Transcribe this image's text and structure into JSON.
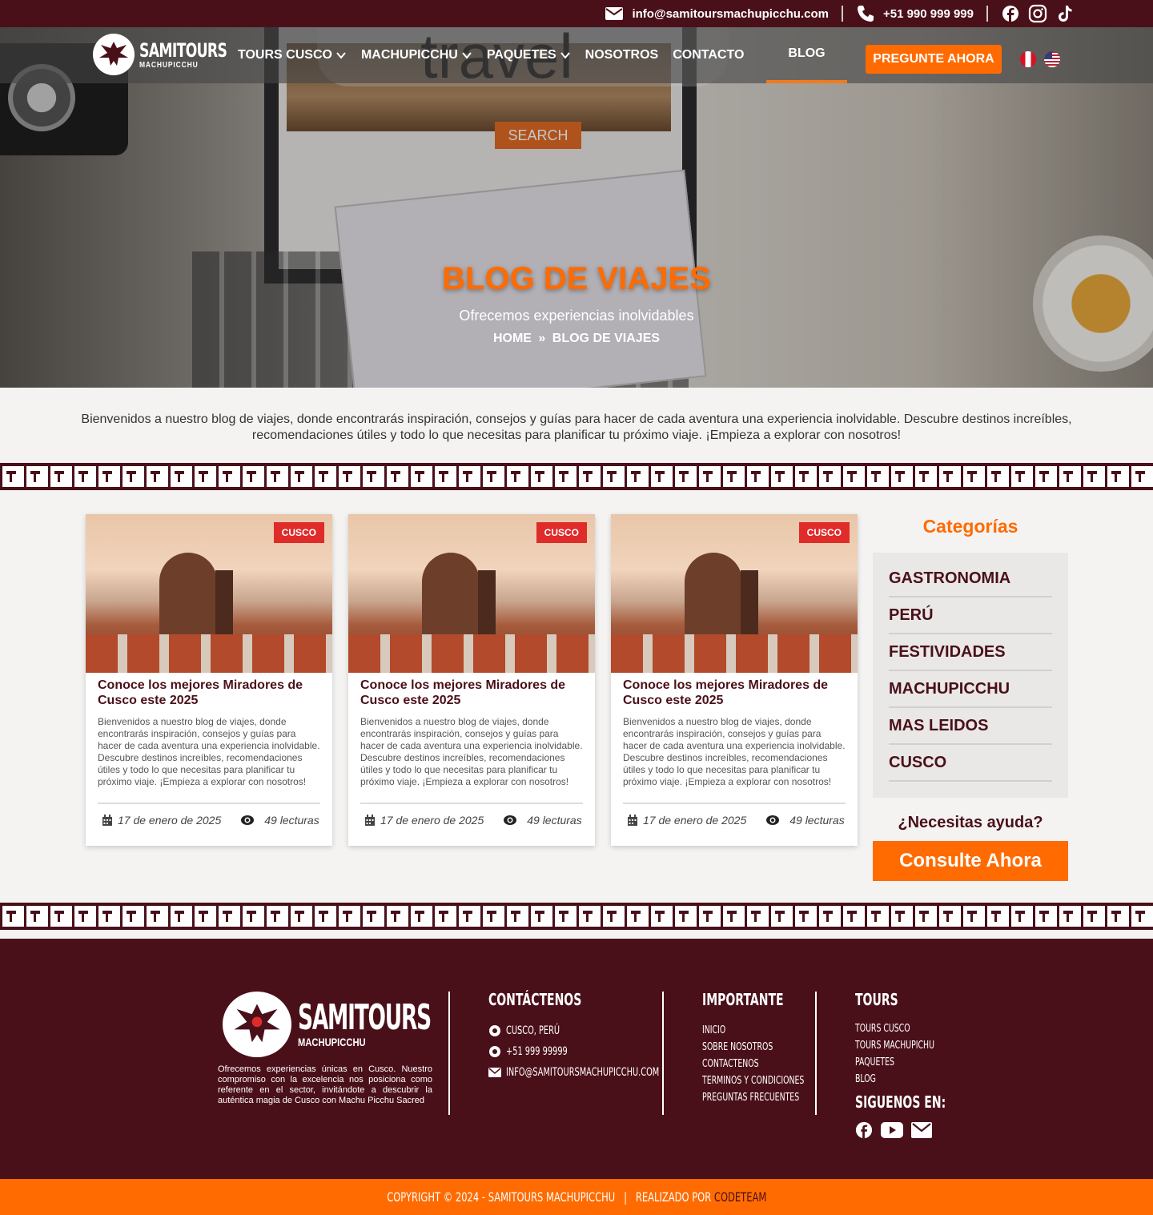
{
  "topbar": {
    "email": "info@samitoursmachupicchu.com",
    "phone": "+51 990 999 999",
    "social_icons": [
      "facebook-icon",
      "instagram-icon",
      "tiktok-icon"
    ]
  },
  "logo": {
    "brand": "SAMITOURS",
    "sub": "MACHUPICCHU"
  },
  "nav": {
    "items": [
      {
        "label": "TOURS CUSCO",
        "dropdown": true
      },
      {
        "label": "MACHUPICCHU",
        "dropdown": true
      },
      {
        "label": "PAQUETES",
        "dropdown": true
      },
      {
        "label": "NOSOTROS",
        "dropdown": false
      },
      {
        "label": "CONTACTO",
        "dropdown": false
      }
    ],
    "active": "BLOG",
    "cta": "PREGUNTE AHORA"
  },
  "hero": {
    "title": "BLOG DE VIAJES",
    "subtitle": "Ofrecemos experiencias inolvidables",
    "breadcrumb": {
      "home": "HOME",
      "separator": "»",
      "current": "BLOG DE VIAJES"
    },
    "image_text": {
      "travel": "travel",
      "search": "SEARCH"
    }
  },
  "intro": "Bienvenidos a nuestro blog de viajes, donde encontrarás inspiración, consejos y guías para hacer de cada aventura una experiencia inolvidable. Descubre destinos increíbles, recomendaciones útiles y todo lo que necesitas para planificar tu próximo viaje. ¡Empieza a explorar con nosotros!",
  "posts": [
    {
      "badge": "CUSCO",
      "title": "Conoce los mejores Miradores de Cusco este 2025",
      "excerpt": "Bienvenidos a nuestro blog de viajes, donde encontrarás inspiración, consejos y guías para hacer de cada aventura una experiencia inolvidable. Descubre destinos increíbles, recomendaciones útiles y todo lo que necesitas para planificar tu próximo viaje. ¡Empieza a explorar con nosotros!",
      "date": "17 de enero de 2025",
      "reads": "49 lecturas"
    },
    {
      "badge": "CUSCO",
      "title": "Conoce los mejores Miradores de Cusco este 2025",
      "excerpt": "Bienvenidos a nuestro blog de viajes, donde encontrarás inspiración, consejos y guías para hacer de cada aventura una experiencia inolvidable. Descubre destinos increíbles, recomendaciones útiles y todo lo que necesitas para planificar tu próximo viaje. ¡Empieza a explorar con nosotros!",
      "date": "17 de enero de 2025",
      "reads": "49 lecturas"
    },
    {
      "badge": "CUSCO",
      "title": "Conoce los mejores Miradores de Cusco este 2025",
      "excerpt": "Bienvenidos a nuestro blog de viajes, donde encontrarás inspiración, consejos y guías para hacer de cada aventura una experiencia inolvidable. Descubre destinos increíbles, recomendaciones útiles y todo lo que necesitas para planificar tu próximo viaje. ¡Empieza a explorar con nosotros!",
      "date": "17 de enero de 2025",
      "reads": "49 lecturas"
    }
  ],
  "sidebar": {
    "title": "Categorías",
    "categories": [
      "GASTRONOMIA",
      "PERÚ",
      "FESTIVIDADES",
      "MACHUPICCHU",
      "MAS LEIDOS",
      "CUSCO"
    ],
    "help": "¿Necesitas ayuda?",
    "cta": "Consulte Ahora"
  },
  "footer": {
    "description": "Ofrecemos experiencias únicas en Cusco. Nuestro compromiso con la excelencia nos posiciona como referente en el sector, invitándote a descubrir la auténtica magia de Cusco con Machu Picchu Sacred",
    "contact": {
      "title": "CONTÁCTENOS",
      "location": "CUSCO, PERÚ",
      "phone": "+51 999 99999",
      "email": "INFO@SAMITOURSMACHUPICCHU.COM"
    },
    "important": {
      "title": "IMPORTANTE",
      "links": [
        "INICIO",
        "SOBRE NOSOTROS",
        "CONTACTENOS",
        "TERMINOS Y CONDICIONES",
        "PREGUNTAS FRECUENTES"
      ]
    },
    "tours": {
      "title": "TOURS",
      "links": [
        "TOURS CUSCO",
        "TOURS MACHUPICHU",
        "PAQUETES",
        "BLOG"
      ]
    },
    "follow": "SIGUENOS EN:",
    "social_icons": [
      "facebook-icon",
      "youtube-icon",
      "mail-icon"
    ]
  },
  "copyright": {
    "text": "COPYRIGHT © 2024 - SAMITOURS MACHUPICCHU",
    "separator": "|",
    "made_by": "REALIZADO POR",
    "team": "CODETEAM"
  },
  "colors": {
    "maroon": "#4a1019",
    "orange": "#ff6b00",
    "badge_red": "#e02b2b"
  }
}
